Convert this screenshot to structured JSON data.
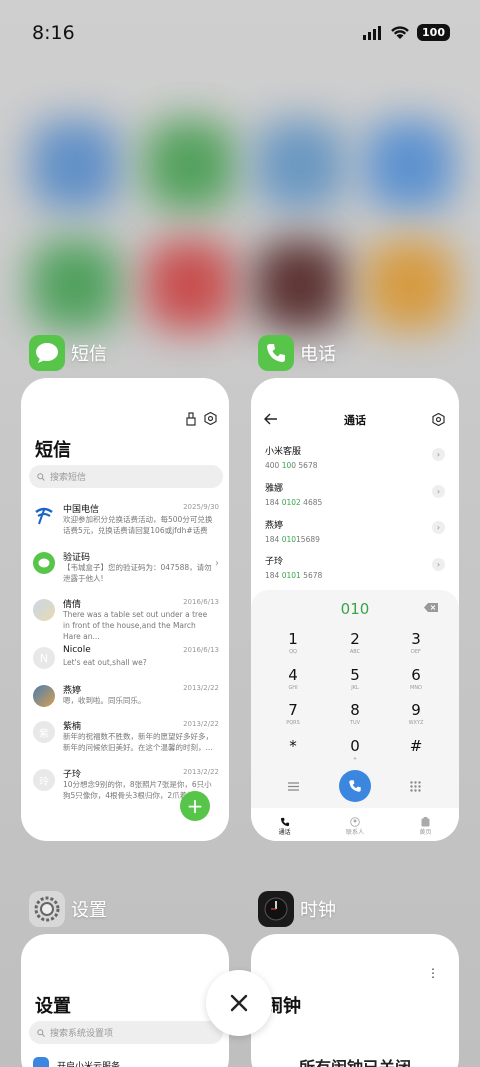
{
  "status_bar": {
    "time": "8:16",
    "battery": "100"
  },
  "apps": {
    "messages": {
      "app_name": "短信",
      "title": "短信",
      "search_placeholder": "搜索短信",
      "items": [
        {
          "name": "中国电信",
          "date": "2025/9/30",
          "preview": "欢迎参加积分兑换话费活动，每500分可兑换话费5元，兑换话费请回复106或jfdh#话费"
        },
        {
          "name": "验证码",
          "date": "",
          "preview": "【韦城盒子】您的验证码为：047588，请勿泄露于他人!"
        },
        {
          "name": "倩倩",
          "date": "2016/6/13",
          "preview": "There was a table set out under a tree in front of the house,and the March Hare an..."
        },
        {
          "name": "Nicole",
          "date": "2016/6/13",
          "preview": "Let's eat out,shall we?"
        },
        {
          "name": "燕婷",
          "date": "2013/2/22",
          "preview": "嗯，收到啦。同乐同乐。"
        },
        {
          "name": "紫楠",
          "date": "2013/2/22",
          "preview": "新年的祝福数不胜数，新年的愿望好多好多，新年的问候依旧美好。在这个温馨的时刻，..."
        },
        {
          "name": "子玲",
          "date": "2013/2/22",
          "preview": "10分想念9别的你，8张照片7张是你，6只小狗5只像你，4根骨头3根归你，2爪着地1..."
        }
      ],
      "avatar_letters": {
        "nicole": "N",
        "zinan": "紫",
        "ziling": "玲"
      },
      "fab_label": "+"
    },
    "phone": {
      "app_name": "电话",
      "title": "通话",
      "contacts": [
        {
          "name": "小米客服",
          "num_a": "400 ",
          "num_hl": "10",
          "num_b": "0 5678"
        },
        {
          "name": "雅娜",
          "num_a": "184 ",
          "num_hl": "0102",
          "num_b": " 4685"
        },
        {
          "name": "燕婷",
          "num_a": "184 ",
          "num_hl": "010",
          "num_b": "15689"
        },
        {
          "name": "子玲",
          "num_a": "184 ",
          "num_hl": "0101",
          "num_b": " 5678"
        }
      ],
      "dial_display": "010",
      "keys": [
        {
          "d": "1",
          "l": "QQ"
        },
        {
          "d": "2",
          "l": "ABC"
        },
        {
          "d": "3",
          "l": "DEF"
        },
        {
          "d": "4",
          "l": "GHI"
        },
        {
          "d": "5",
          "l": "JKL"
        },
        {
          "d": "6",
          "l": "MNO"
        },
        {
          "d": "7",
          "l": "PQRS"
        },
        {
          "d": "8",
          "l": "TUV"
        },
        {
          "d": "9",
          "l": "WXYZ"
        },
        {
          "d": "*",
          "l": ""
        },
        {
          "d": "0",
          "l": "+"
        },
        {
          "d": "#",
          "l": ""
        }
      ],
      "nav": {
        "calls": "通话",
        "contacts": "联系人",
        "yellow_pages": "黄页"
      }
    },
    "settings": {
      "app_name": "设置",
      "title": "设置",
      "search_placeholder": "搜索系统设置项",
      "first_item": "开启小米云服务"
    },
    "clock": {
      "app_name": "时钟",
      "title": "闹钟",
      "empty_text": "所有闹钟已关闭"
    }
  },
  "colors": {
    "green": "#57c54a",
    "blue": "#3b87e0",
    "dial_green": "#3aa44a"
  }
}
